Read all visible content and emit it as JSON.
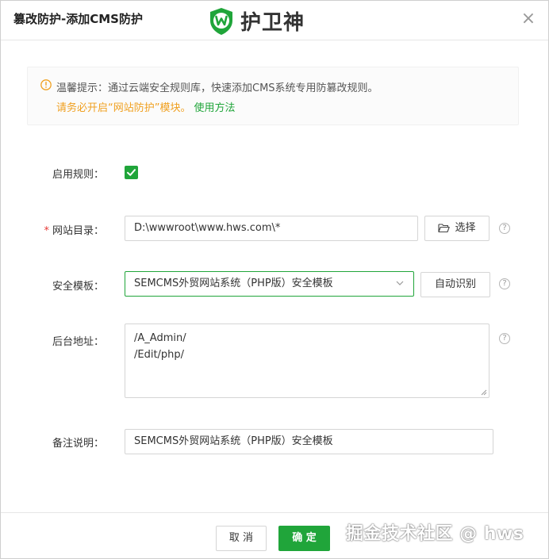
{
  "dialog": {
    "title": "篡改防护-添加CMS防护",
    "brand_name": "护卫神",
    "close_symbol": "×"
  },
  "notice": {
    "icon": "info-circle-icon",
    "line1": "温馨提示：通过云端安全规则库，快速添加CMS系统专用防篡改规则。",
    "line2": "请务必开启“网站防护”模块。",
    "link_text": "使用方法"
  },
  "form": {
    "enable_rule": {
      "label": "启用规则：",
      "checked": true
    },
    "site_dir": {
      "required_mark": "*",
      "label": "网站目录：",
      "value": "D:\\wwwroot\\www.hws.com\\*",
      "browse_label": "选择"
    },
    "template": {
      "label": "安全模板：",
      "selected": "SEMCMS外贸网站系统（PHP版）安全模板",
      "auto_detect_label": "自动识别"
    },
    "admin_path": {
      "label": "后台地址：",
      "lines": [
        "/A_Admin/",
        "/Edit/php/"
      ]
    },
    "remark": {
      "label": "备注说明：",
      "value": "SEMCMS外贸网站系统（PHP版）安全模板"
    },
    "help_symbol": "?"
  },
  "footer": {
    "cancel_label": "取 消",
    "confirm_label": "确 定"
  },
  "watermark": "掘金技术社区 @ hws",
  "colors": {
    "accent": "#20a53a",
    "warning": "#f0a020",
    "required": "#e53935"
  }
}
